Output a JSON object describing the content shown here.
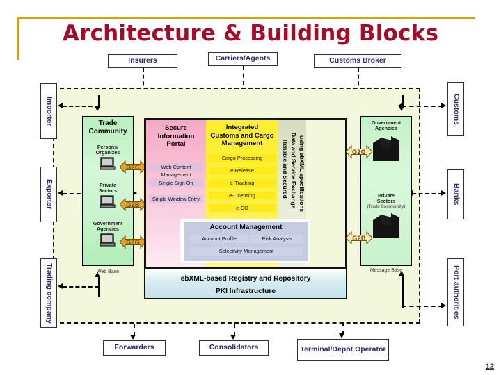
{
  "slide": {
    "title": "Architecture & Building Blocks",
    "number": "12",
    "accent_gold": "#c8a325",
    "title_color": "#aa0a2a"
  },
  "top_actors": [
    {
      "label": "Insurers"
    },
    {
      "label": "Carriers/Agents"
    },
    {
      "label": "Customs Broker"
    }
  ],
  "left_actors": [
    {
      "label": "Importer"
    },
    {
      "label": "Exporter"
    },
    {
      "label": "Trading company"
    }
  ],
  "right_actors": [
    {
      "label": "Customs"
    },
    {
      "label": "Banks"
    },
    {
      "label": "Port authorities"
    }
  ],
  "bottom_actors": [
    {
      "label": "Forwarders"
    },
    {
      "label": "Consolidators"
    },
    {
      "label": "Terminal/Depot Operator"
    }
  ],
  "trade_community": {
    "title_line1": "Trade",
    "title_line2": "Community",
    "caption": "Web Base",
    "items": [
      {
        "line1": "Persons/",
        "line2": "Organizes",
        "icon": "computer-icon",
        "arrow": "G2C"
      },
      {
        "line1": "Private",
        "line2": "Sectors",
        "icon": "computer-icon",
        "arrow": "G2B"
      },
      {
        "line1": "Government",
        "line2": "Agencies",
        "icon": "computer-icon",
        "arrow": "G2G"
      }
    ]
  },
  "portal_panel": {
    "title_line1": "Secure Information",
    "title_line2": "Portal",
    "rows": [
      "Web Content Management",
      "Single Sign On",
      "Single Window Entry"
    ],
    "ellipsis": "⋮"
  },
  "iccm_panel": {
    "title_line1": "Integrated",
    "title_line2": "Customs and Cargo",
    "title_line3": "Management",
    "rows": [
      "Cargo Processing",
      "e-Release",
      "e-Tracking",
      "e-Licensing",
      "e-CO"
    ],
    "ellipsis": "⋮"
  },
  "exchange_panel": {
    "line1": "Reliable and Secured",
    "line2": "Data and Service Exchange",
    "line3": "using ebXML specifications"
  },
  "account_management": {
    "title": "Account Management",
    "rows_top": [
      "Account Profile",
      "Risk Analysis"
    ],
    "rows_bottom": [
      "Selectivity Management"
    ]
  },
  "infrastructure_bar": {
    "rows": [
      "ebXML-based Registry and Repository",
      "PKI Infrastructure"
    ]
  },
  "gov_panel": {
    "caption": "Message Base",
    "items": [
      {
        "line1": "Government",
        "line2": "Agencies",
        "sub": "",
        "icon": "building-icon",
        "arrow": "G2G"
      },
      {
        "line1": "Private",
        "line2": "Sectors",
        "sub": "(Trade Community)",
        "icon": "building-icon",
        "arrow": "G2B"
      }
    ]
  }
}
